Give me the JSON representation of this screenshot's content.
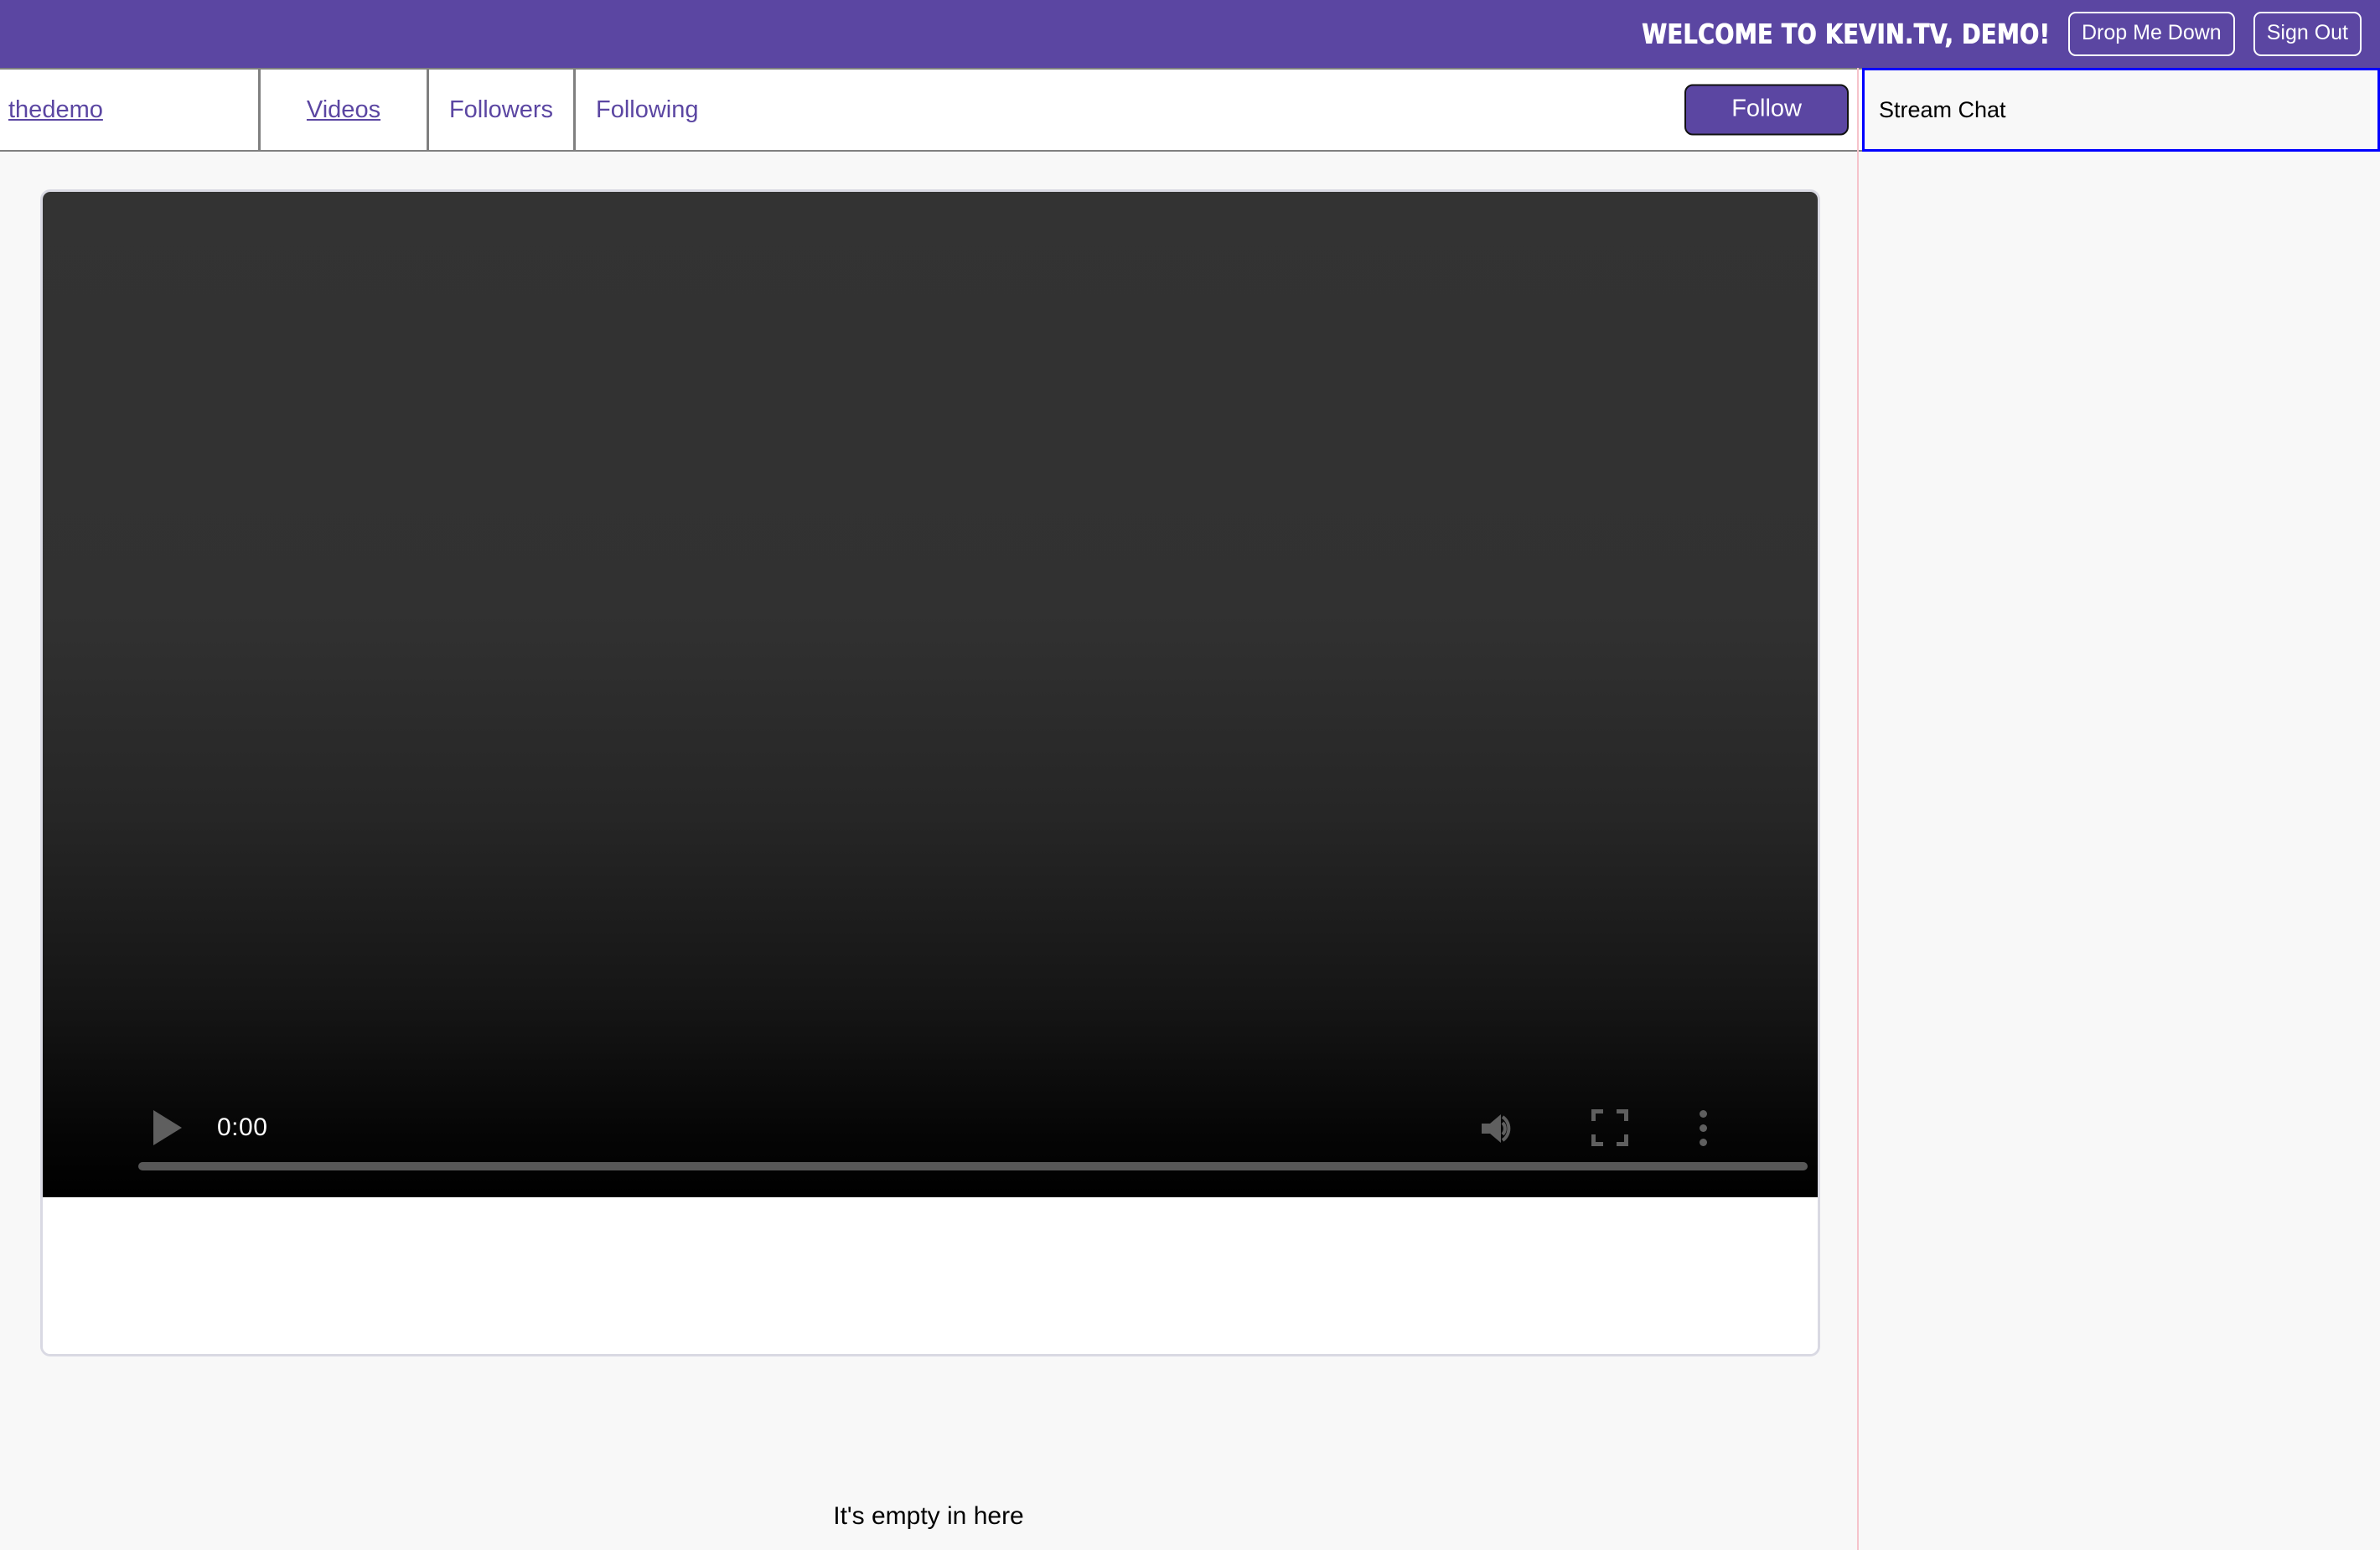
{
  "header": {
    "welcome_text": "WELCOME TO KEVIN.TV, DEMO!",
    "dropdown_button_label": "Drop Me Down",
    "signout_button_label": "Sign Out",
    "background_color": "#5b46a2"
  },
  "nav": {
    "tabs": [
      {
        "label": "thedemo",
        "underlined": true
      },
      {
        "label": "Videos",
        "underlined": true
      },
      {
        "label": "Followers",
        "underlined": false
      },
      {
        "label": "Following",
        "underlined": false
      }
    ],
    "follow_button_label": "Follow",
    "link_color": "#5b46a2"
  },
  "chat": {
    "header_label": "Stream Chat",
    "focus_border_color": "#0000ff",
    "divider_color": "#f6c3cb",
    "messages": []
  },
  "main": {
    "video": {
      "current_time": "0:00",
      "progress_percent": 0,
      "icons": {
        "play": "play-icon",
        "volume": "volume-icon",
        "fullscreen": "fullscreen-icon",
        "more": "kebab-menu-icon"
      }
    },
    "empty_state_message": "It's empty in here"
  }
}
